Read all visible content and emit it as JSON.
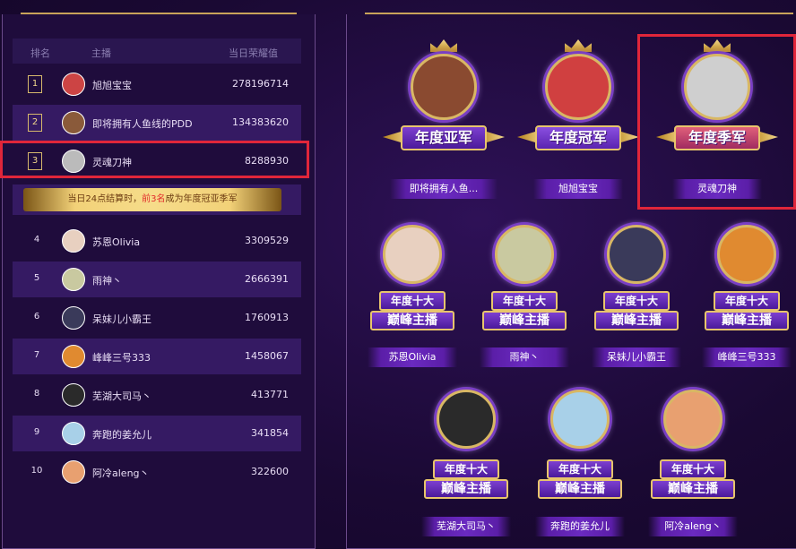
{
  "leaderboard": {
    "headers": {
      "rank": "排名",
      "streamer": "主播",
      "score": "当日荣耀值"
    },
    "top3": [
      {
        "rank": "1",
        "name": "旭旭宝宝",
        "score": "278196714",
        "avatar_color": "#c44"
      },
      {
        "rank": "2",
        "name": "即将拥有人鱼线的PDD",
        "score": "134383620",
        "avatar_color": "#8a5a3a"
      },
      {
        "rank": "3",
        "name": "灵魂刀神",
        "score": "8288930",
        "avatar_color": "#bbb"
      }
    ],
    "notice": {
      "prefix": "当日24点结算时，",
      "highlight": "前3名",
      "suffix": "成为年度冠亚季军"
    },
    "rest": [
      {
        "rank": "4",
        "name": "苏恩Olivia",
        "score": "3309529",
        "avatar_color": "#e8d0c0"
      },
      {
        "rank": "5",
        "name": "雨神丶",
        "score": "2666391",
        "avatar_color": "#c9c9a0"
      },
      {
        "rank": "6",
        "name": "呆妹儿小霸王",
        "score": "1760913",
        "avatar_color": "#3a3a5a"
      },
      {
        "rank": "7",
        "name": "峰峰三号333",
        "score": "1458067",
        "avatar_color": "#e08a30"
      },
      {
        "rank": "8",
        "name": "芜湖大司马丶",
        "score": "413771",
        "avatar_color": "#2a2a2a"
      },
      {
        "rank": "9",
        "name": "奔跑的姜允儿",
        "score": "341854",
        "avatar_color": "#a8d0e8"
      },
      {
        "rank": "10",
        "name": "阿冷aleng丶",
        "score": "322600",
        "avatar_color": "#e8a070"
      }
    ]
  },
  "awards": {
    "top": [
      {
        "title": "年度亚军",
        "name": "即将拥有人鱼...",
        "avatar_color": "#8a4a30"
      },
      {
        "title": "年度冠军",
        "name": "旭旭宝宝",
        "avatar_color": "#d04040"
      },
      {
        "title": "年度季军",
        "name": "灵魂刀神",
        "avatar_color": "#cfcfcf"
      }
    ],
    "peak_line1": "年度十大",
    "peak_line2": "巅峰主播",
    "peak": [
      {
        "name": "苏恩Olivia",
        "avatar_color": "#e8d0c0"
      },
      {
        "name": "雨神丶",
        "avatar_color": "#c9c9a0"
      },
      {
        "name": "呆妹儿小霸王",
        "avatar_color": "#3a3a5a"
      },
      {
        "name": "峰峰三号333",
        "avatar_color": "#e08a30"
      },
      {
        "name": "芜湖大司马丶",
        "avatar_color": "#2a2a2a"
      },
      {
        "name": "奔跑的姜允儿",
        "avatar_color": "#a8d0e8"
      },
      {
        "name": "阿冷aleng丶",
        "avatar_color": "#e8a070"
      }
    ]
  }
}
